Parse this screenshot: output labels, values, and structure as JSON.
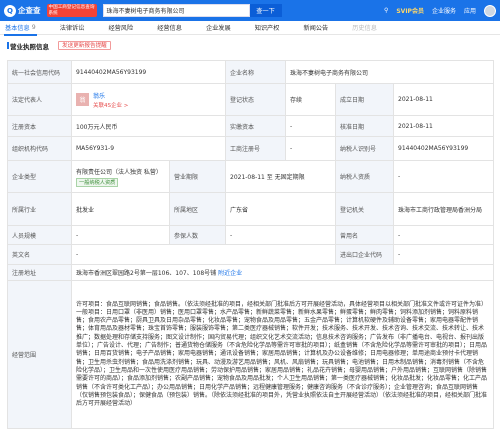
{
  "header": {
    "logo_text": "企查查",
    "promo_text": "中国工商登记信息查询系统",
    "search_value": "珠海不妻树电子商务有限公司",
    "search_button": "查一下",
    "right": {
      "svip": "SVIP会员",
      "enterprise": "企业服务",
      "apps": "应用"
    }
  },
  "tabs": [
    {
      "label": "基本信息",
      "count": "9",
      "active": true
    },
    {
      "label": "法律诉讼",
      "count": ""
    },
    {
      "label": "经营风险",
      "count": ""
    },
    {
      "label": "经营信息",
      "count": ""
    },
    {
      "label": "企业发展",
      "count": ""
    },
    {
      "label": "知识产权",
      "count": ""
    },
    {
      "label": "新闻公告",
      "count": ""
    },
    {
      "label": "历史信息",
      "count": "",
      "light": true
    }
  ],
  "section": {
    "title": "营业执照信息",
    "update_button": "发送更新报告提醒"
  },
  "info": {
    "credit_code_label": "统一社会信用代码",
    "credit_code": "91440402MA56Y93199",
    "company_name_label": "企业名称",
    "company_name": "珠海不妻树电子商务有限公司",
    "legal_rep_label": "法定代表人",
    "legal_rep_avatar": "翁",
    "legal_rep_name": "翁乐",
    "legal_rep_link": "关联4S企业 >",
    "reg_status_label": "登记状态",
    "reg_status": "存续",
    "est_date_label": "成立日期",
    "est_date": "2021-08-11",
    "reg_capital_label": "注册资本",
    "reg_capital": "100万元人民币",
    "paid_capital_label": "实缴资本",
    "paid_capital": "-",
    "approval_date_label": "核准日期",
    "approval_date": "2021-08-11",
    "org_code_label": "组织机构代码",
    "org_code": "MA56Y931-9",
    "biz_reg_no_label": "工商注册号",
    "biz_reg_no": "-",
    "taxpayer_id_label": "纳税人识别号",
    "taxpayer_id": "91440402MA56Y93199",
    "company_type_label": "企业类型",
    "company_type": "有限责任公司（法人独资 私营）",
    "company_type_tag": "一般纳税人资质",
    "biz_term_label": "营业期限",
    "biz_term": "2021-08-11 至 无固定期限",
    "taxpayer_qual_label": "纳税人资质",
    "taxpayer_qual": "-",
    "industry_label": "所属行业",
    "industry": "批发业",
    "region_label": "所属地区",
    "region": "广东省",
    "reg_authority_label": "登记机关",
    "reg_authority": "珠海市工商行政管理局香洲分局",
    "staff_label": "人员规模",
    "staff": "-",
    "insured_label": "参保人数",
    "insured": "-",
    "former_name_label": "曾用名",
    "former_name": "-",
    "english_name_label": "英文名",
    "english_name": "-",
    "import_export_label": "进出口企业代码",
    "import_export": "-",
    "address_label": "注册地址",
    "address": "珠海市香洲区翠园路2号第一层106、107、108号铺",
    "address_link": "附近企业",
    "scope_label": "经营范围",
    "scope": "许可项目：食品互联网销售；食品销售。（依法须经批准的项目，经相关部门批准后方可开展经营活动，具体经营项目以相关部门批准文件或许可证件为准）一般项目：日用口罩（非医用）销售；医用口罩零售；水产品零售；新鲜蔬菜零售；新鲜水果零售；鲜蛋零售；鲜肉零售；饲料添加剂销售；饲料原料销售；食用农产品零售；厨具卫具及日用杂品零售；化妆品零售；宠物食品及用品零售；五金产品零售；计算机软硬件及辅助设备零售；家用电器零配件销售；体育用品及器材零售；珠宝首饰零售；服装服饰零售；第二类医疗器械销售；软件开发；技术服务、技术开发、技术咨询、技术交流、技术转让、技术推广；数据处理和存储支持服务；图文设计制作；国内贸易代理；组织文化艺术交流活动；信息技术咨询服务；广告发布（非广播电台、电视台、报刊出版单位）；广告设计、代理；广告制作；普通货物仓储服务（不含危险化学品等需许可审批的项目）；纸盒销售（不含危险化学品等需许可审批的项目）；日用品销售；日用百货销售；电子产品销售；家用电器销售；通讯设备销售；家居用品销售；计算机及办公设备维修；日用电器修理；单用途商业预付卡代理销售；卫生用杀虫剂销售；食品用洗涤剂销售；玩具、动漫及游艺用品销售；风机、风扇销售；玩具销售；电池销售；日用木制品销售；消毒剂销售（不含危险化学品）；卫生用品和一次性使用医疗用品销售；劳动保护用品销售；家居用品销售；礼品花卉销售；母婴用品销售；户外用品销售；互联网销售（除销售需要许可的商品）；食品添加剂销售；农副产品销售；宠物食品及用品批发；个人卫生用品销售；第一类医疗器械销售；化妆品批发；化妆品零售；化工产品销售（不含许可类化工产品）；办公用品销售；日用化学产品销售；远程健康管理服务；健康咨询服务（不含诊疗服务）；企业管理咨询；食品互联网销售（仅销售预包装食品）；保健食品（预包装）销售。（除依法须经批准的项目外，凭营业执照依法自主开展经营活动）（依法须经批准的项目，经相关部门批准后方可开展经营活动）"
  }
}
